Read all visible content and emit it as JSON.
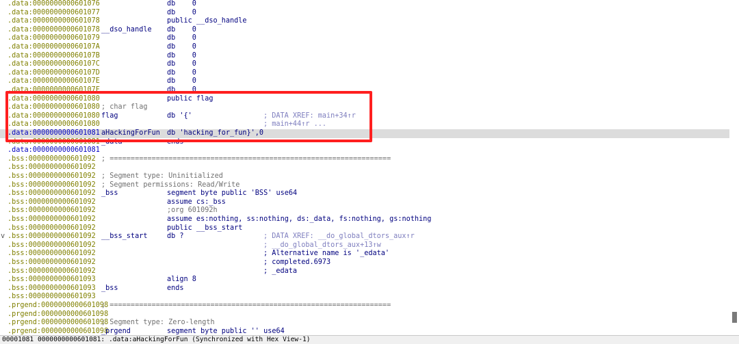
{
  "listing": {
    "lines": [
      {
        "addr": ".data:0000000000601076",
        "label": "",
        "instr": "db    0",
        "comment": ""
      },
      {
        "addr": ".data:0000000000601077",
        "label": "",
        "instr": "db    0",
        "comment": ""
      },
      {
        "addr": ".data:0000000000601078",
        "label": "",
        "instr": "public __dso_handle",
        "comment": ""
      },
      {
        "addr": ".data:0000000000601078",
        "label": "__dso_handle",
        "instr": "db    0",
        "comment": ""
      },
      {
        "addr": ".data:0000000000601079",
        "label": "",
        "instr": "db    0",
        "comment": ""
      },
      {
        "addr": ".data:000000000060107A",
        "label": "",
        "instr": "db    0",
        "comment": ""
      },
      {
        "addr": ".data:000000000060107B",
        "label": "",
        "instr": "db    0",
        "comment": ""
      },
      {
        "addr": ".data:000000000060107C",
        "label": "",
        "instr": "db    0",
        "comment": ""
      },
      {
        "addr": ".data:000000000060107D",
        "label": "",
        "instr": "db    0",
        "comment": ""
      },
      {
        "addr": ".data:000000000060107E",
        "label": "",
        "instr": "db    0",
        "comment": ""
      },
      {
        "addr": ".data:000000000060107F",
        "label": "",
        "instr": "db    0",
        "comment": ""
      },
      {
        "addr": ".data:0000000000601080",
        "label": "",
        "instr": "public flag",
        "comment": ""
      },
      {
        "addr": ".data:0000000000601080",
        "label": "; char flag",
        "instr": "",
        "comment": "",
        "isComment": true
      },
      {
        "addr": ".data:0000000000601080",
        "label": "flag",
        "instr": "db '{'",
        "comment": "; DATA XREF: main+34↑r"
      },
      {
        "addr": ".data:0000000000601080",
        "label": "",
        "instr": "",
        "comment": "; main+44↑r ..."
      },
      {
        "addr": ".data:0000000000601081",
        "label": "aHackingForFun",
        "instr": "db 'hacking_for_fun}',0",
        "comment": "",
        "highlight": true,
        "selected": true
      },
      {
        "addr": ".data:0000000000601081",
        "label": "_data",
        "instr": "ends",
        "comment": ""
      },
      {
        "addr": ".data:0000000000601081",
        "label": "",
        "instr": "",
        "comment": "",
        "selected": true
      },
      {
        "addr": ".bss:0000000000601092",
        "label": "; ===================================================================",
        "instr": "",
        "comment": "",
        "isComment": true
      },
      {
        "addr": ".bss:0000000000601092",
        "label": "",
        "instr": "",
        "comment": ""
      },
      {
        "addr": ".bss:0000000000601092",
        "label": "; Segment type: Uninitialized",
        "instr": "",
        "comment": "",
        "isComment": true
      },
      {
        "addr": ".bss:0000000000601092",
        "label": "; Segment permissions: Read/Write",
        "instr": "",
        "comment": "",
        "isComment": true
      },
      {
        "addr": ".bss:0000000000601092",
        "label": "_bss",
        "instr": "segment byte public 'BSS' use64",
        "comment": ""
      },
      {
        "addr": ".bss:0000000000601092",
        "label": "",
        "instr": "assume cs:_bss",
        "comment": ""
      },
      {
        "addr": ".bss:0000000000601092",
        "label": "",
        "instr": ";org 601092h",
        "comment": "",
        "instrComment": true
      },
      {
        "addr": ".bss:0000000000601092",
        "label": "",
        "instr": "assume es:nothing, ss:nothing, ds:_data, fs:nothing, gs:nothing",
        "comment": ""
      },
      {
        "addr": ".bss:0000000000601092",
        "label": "",
        "instr": "public __bss_start",
        "comment": ""
      },
      {
        "addr": ".bss:0000000000601092",
        "label": "__bss_start",
        "instr": "db ?",
        "comment": "; DATA XREF: __do_global_dtors_aux↑r",
        "gutter": "v"
      },
      {
        "addr": ".bss:0000000000601092",
        "label": "",
        "instr": "",
        "comment": "; __do_global_dtors_aux+13↑w"
      },
      {
        "addr": ".bss:0000000000601092",
        "label": "",
        "instr": "",
        "comment": "; Alternative name is '_edata'",
        "darkComment": true
      },
      {
        "addr": ".bss:0000000000601092",
        "label": "",
        "instr": "",
        "comment": "; completed.6973",
        "darkComment": true
      },
      {
        "addr": ".bss:0000000000601092",
        "label": "",
        "instr": "",
        "comment": "; _edata",
        "darkComment": true
      },
      {
        "addr": ".bss:0000000000601093",
        "label": "",
        "instr": "align 8",
        "comment": ""
      },
      {
        "addr": ".bss:0000000000601093",
        "label": "_bss",
        "instr": "ends",
        "comment": ""
      },
      {
        "addr": ".bss:0000000000601093",
        "label": "",
        "instr": "",
        "comment": ""
      },
      {
        "addr": ".prgend:0000000000601098",
        "label": "; ===================================================================",
        "instr": "",
        "comment": "",
        "isComment": true
      },
      {
        "addr": ".prgend:0000000000601098",
        "label": "",
        "instr": "",
        "comment": ""
      },
      {
        "addr": ".prgend:0000000000601098",
        "label": "; Segment type: Zero-length",
        "instr": "",
        "comment": "",
        "isComment": true
      },
      {
        "addr": ".prgend:0000000000601098",
        "label": "_prgend",
        "instr": "segment byte public '' use64",
        "comment": ""
      }
    ]
  },
  "statusbar": {
    "text": "00001081 0000000000601081: .data:aHackingForFun (Synchronized with Hex View-1)"
  },
  "colors": {
    "address": "#808000",
    "selected_address": "#0000c0",
    "code": "#00007f",
    "comment": "#707070",
    "xref_comment": "#7f7fbf",
    "annotation_box": "#ff1f1f",
    "highlight_row": "#dcdcdc"
  }
}
